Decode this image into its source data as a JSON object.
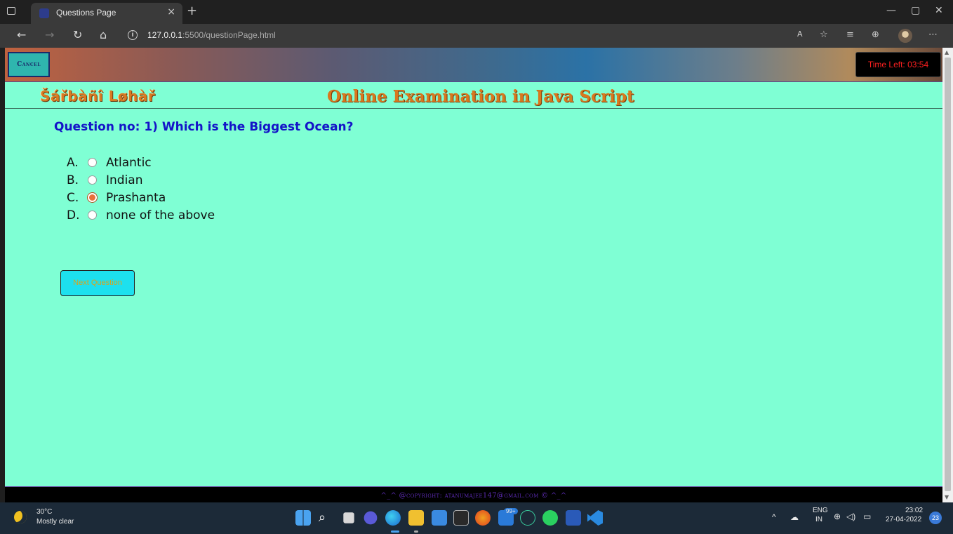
{
  "browser": {
    "tab_title": "Questions Page",
    "tab_close": "×",
    "new_tab": "+",
    "url_host": "127.0.0.1",
    "url_rest": ":5500/questionPage.html",
    "win_min": "—",
    "win_max": "▢",
    "win_close": "✕"
  },
  "page": {
    "cancel_label": "Cancel",
    "timer": "Time Left: 03:54",
    "brand": "Šářbàñî Løhàř",
    "title": "Online Examination in Java Script",
    "question": "Question no: 1) Which is the Biggest Ocean?",
    "options": [
      {
        "letter": "A.",
        "text": "Atlantic",
        "checked": false
      },
      {
        "letter": "B.",
        "text": "Indian",
        "checked": false
      },
      {
        "letter": "C.",
        "text": "Prashanta",
        "checked": true
      },
      {
        "letter": "D.",
        "text": "none of the above",
        "checked": false
      }
    ],
    "next_label": "Next Question",
    "footer": "^_^ @copyright: atanumajee147@gmail.com © ^_^"
  },
  "taskbar": {
    "temp": "30°C",
    "weather": "Mostly clear",
    "lang_top": "ENG",
    "lang_bottom": "IN",
    "time": "23:02",
    "date": "27-04-2022",
    "notifications": "23",
    "badge_99": "99+"
  },
  "colors": {
    "page_bg": "#7fffd4",
    "question": "#1414c8",
    "title": "#d9781e",
    "timer_text": "#ff2020"
  }
}
